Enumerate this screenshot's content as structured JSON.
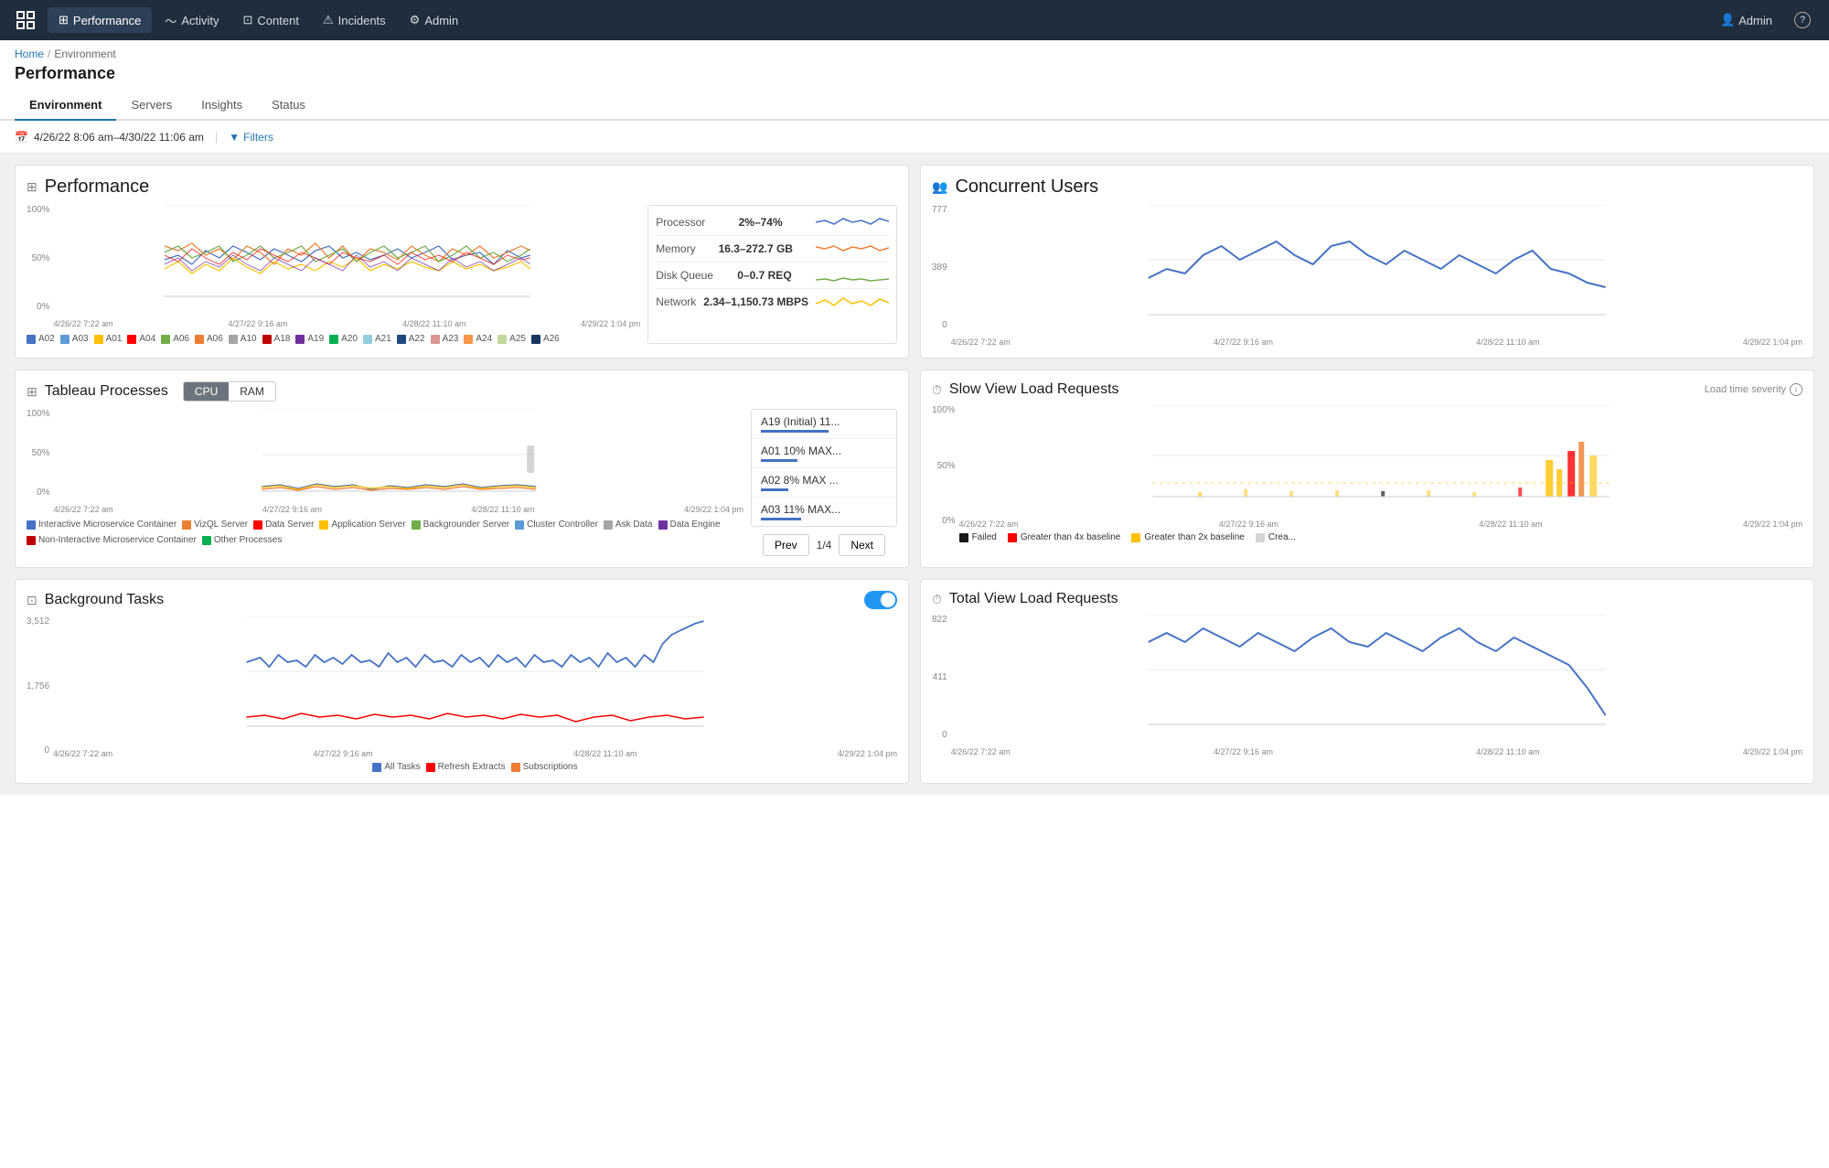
{
  "topnav": {
    "logo_icon": "grid-icon",
    "items": [
      {
        "label": "Performance",
        "icon": "performance-icon",
        "active": true
      },
      {
        "label": "Activity",
        "icon": "activity-icon",
        "active": false
      },
      {
        "label": "Content",
        "icon": "content-icon",
        "active": false
      },
      {
        "label": "Incidents",
        "icon": "incidents-icon",
        "active": false
      },
      {
        "label": "Admin",
        "icon": "admin-icon",
        "active": false
      }
    ],
    "right_items": [
      {
        "label": "Admin",
        "icon": "user-icon"
      },
      {
        "label": "?",
        "icon": "help-icon"
      }
    ]
  },
  "breadcrumb": {
    "items": [
      "Home",
      "Environment"
    ],
    "separator": "/"
  },
  "page_title": "Performance",
  "sub_tabs": [
    {
      "label": "Environment",
      "active": true
    },
    {
      "label": "Servers",
      "active": false
    },
    {
      "label": "Insights",
      "active": false
    },
    {
      "label": "Status",
      "active": false
    }
  ],
  "filter_bar": {
    "date_range": "4/26/22 8:06 am–4/30/22 11:06 am",
    "filters_label": "Filters"
  },
  "performance_card": {
    "title": "Performance",
    "y_labels": [
      "100%",
      "50%",
      "0%"
    ],
    "x_labels": [
      "4/26/22 7:22 am",
      "4/27/22 9:16 am",
      "4/28/22 11:10 am",
      "4/29/22 1:04 pm"
    ],
    "metrics": [
      {
        "name": "Processor",
        "value": "2%–74%",
        "color": "#4472c4"
      },
      {
        "name": "Memory",
        "value": "16.3–272.7 GB",
        "color": "#ed7d31"
      },
      {
        "name": "Disk Queue",
        "value": "0–0.7 REQ",
        "color": "#70ad47"
      },
      {
        "name": "Network",
        "value": "2.34–1,150.73 MBPS",
        "color": "#ffc000"
      }
    ],
    "legend": [
      {
        "label": "A02",
        "color": "#4472c4"
      },
      {
        "label": "A03",
        "color": "#5b9bd5"
      },
      {
        "label": "A01",
        "color": "#ffc000"
      },
      {
        "label": "A04",
        "color": "#ff0000"
      },
      {
        "label": "A06",
        "color": "#70ad47"
      },
      {
        "label": "A06",
        "color": "#ed7d31"
      },
      {
        "label": "A10",
        "color": "#a5a5a5"
      },
      {
        "label": "A18",
        "color": "#c00000"
      },
      {
        "label": "A19",
        "color": "#7030a0"
      },
      {
        "label": "A20",
        "color": "#00b050"
      },
      {
        "label": "A21",
        "color": "#92cddc"
      },
      {
        "label": "A22",
        "color": "#1f497d"
      },
      {
        "label": "A23",
        "color": "#d99694"
      },
      {
        "label": "A24",
        "color": "#f79646"
      },
      {
        "label": "A25",
        "color": "#c3d69b"
      },
      {
        "label": "A26",
        "color": "#17375e"
      }
    ]
  },
  "tableau_processes_card": {
    "title": "Tableau Processes",
    "cpu_label": "CPU",
    "ram_label": "RAM",
    "y_labels": [
      "100%",
      "50%",
      "0%"
    ],
    "x_labels": [
      "4/26/22 7:22 am",
      "4/27/22 9:16 am",
      "4/28/22 11:10 am",
      "4/29/22 1:04 pm"
    ],
    "process_list": [
      {
        "name": "A19 (Initial) 11...",
        "bar_pct": 85
      },
      {
        "name": "A01 10% MAX...",
        "bar_pct": 45
      },
      {
        "name": "A02 8% MAX ...",
        "bar_pct": 35
      },
      {
        "name": "A03 11% MAX...",
        "bar_pct": 50
      }
    ],
    "pagination": {
      "current": 1,
      "total": 4,
      "prev_label": "Prev",
      "next_label": "Next"
    },
    "legend": [
      {
        "label": "Interactive Microservice Container",
        "color": "#4472c4"
      },
      {
        "label": "VizQL Server",
        "color": "#ed7d31"
      },
      {
        "label": "Data Server",
        "color": "#ff0000"
      },
      {
        "label": "Application Server",
        "color": "#ffc000"
      },
      {
        "label": "Backgrounder Server",
        "color": "#70ad47"
      },
      {
        "label": "Cluster Controller",
        "color": "#5b9bd5"
      },
      {
        "label": "Ask Data",
        "color": "#a5a5a5"
      },
      {
        "label": "Data Engine",
        "color": "#7030a0"
      },
      {
        "label": "Non-Interactive Microservice Container",
        "color": "#c00000"
      },
      {
        "label": "Other Processes",
        "color": "#00b050"
      }
    ]
  },
  "background_tasks_card": {
    "title": "Background Tasks",
    "toggle_on": true,
    "y_labels": [
      "3,512",
      "1,756",
      "0"
    ],
    "x_labels": [
      "4/26/22 7:22 am",
      "4/27/22 9:16 am",
      "4/28/22 11:10 am",
      "4/29/22 1:04 pm"
    ],
    "legend": [
      {
        "label": "All Tasks",
        "color": "#4472c4"
      },
      {
        "label": "Refresh Extracts",
        "color": "#ff0000"
      },
      {
        "label": "Subscriptions",
        "color": "#ed7d31"
      }
    ]
  },
  "concurrent_users_card": {
    "title": "Concurrent Users",
    "y_labels": [
      "777",
      "389",
      "0"
    ],
    "x_labels": [
      "4/26/22 7:22 am",
      "4/27/22 9:16 am",
      "4/28/22 11:10 am",
      "4/29/22 1:04 pm"
    ]
  },
  "slow_view_card": {
    "title": "Slow View Load Requests",
    "severity_label": "Load time severity",
    "y_labels": [
      "100%",
      "50%",
      "0%"
    ],
    "x_labels": [
      "4/26/22 7:22 am",
      "4/27/22 9:16 am",
      "4/28/22 11:10 am",
      "4/29/22 1:04 pm"
    ],
    "legend": [
      {
        "label": "Failed",
        "color": "#1a1a1a"
      },
      {
        "label": "Greater than 4x baseline",
        "color": "#ff0000"
      },
      {
        "label": "Greater than 2x baseline",
        "color": "#ffc000"
      },
      {
        "label": "Crea...",
        "color": "#d4d4d4"
      }
    ]
  },
  "total_view_card": {
    "title": "Total View Load Requests",
    "y_labels": [
      "822",
      "411",
      "0"
    ],
    "x_labels": [
      "4/26/22 7:22 am",
      "4/27/22 9:16 am",
      "4/28/22 11:10 am",
      "4/29/22 1:04 pm"
    ]
  }
}
